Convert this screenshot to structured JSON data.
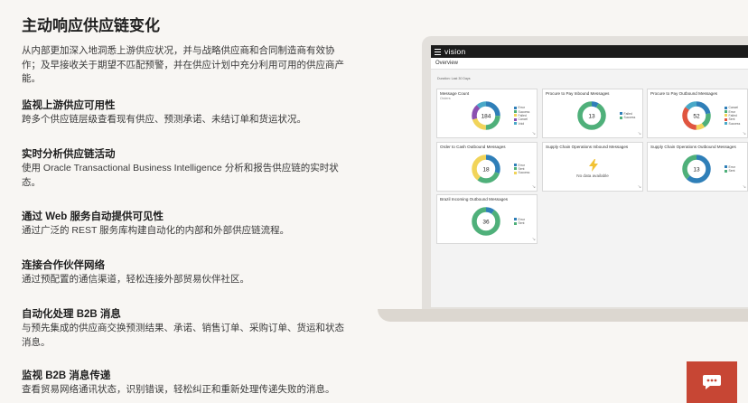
{
  "title": "主动响应供应链变化",
  "lead": "从内部更加深入地洞悉上游供应状况，并与战略供应商和合同制造商有效协作；及早接收关于期望不匹配预警，并在供应计划中充分利用可用的供应商产能。",
  "features": [
    {
      "heading": "监视上游供应可用性",
      "body": "跨多个供应链层级查看现有供应、预测承诺、未结订单和货运状况。"
    },
    {
      "heading": "实时分析供应链活动",
      "body": "使用 Oracle Transactional Business Intelligence 分析和报告供应链的实时状态。"
    },
    {
      "heading": "通过 Web 服务自动提供可见性",
      "body": "通过广泛的 REST 服务库构建自动化的内部和外部供应链流程。"
    },
    {
      "heading": "连接合作伙伴网络",
      "body": "通过预配置的通信渠道，轻松连接外部贸易伙伴社区。"
    },
    {
      "heading": "自动化处理 B2B 消息",
      "body": "与预先集成的供应商交换预测结果、承诺、销售订单、采购订单、货运和状态消息。"
    },
    {
      "heading": "监视 B2B 消息传递",
      "body": "查看贸易网络通讯状态，识别错误，轻松纠正和重新处理传递失败的消息。"
    }
  ],
  "screen": {
    "brand": "vision",
    "page": "Overview",
    "duration": "Duration: Last 30 Days",
    "cards": [
      {
        "title": "Message Count",
        "subtitle": "Orders",
        "total": "184",
        "segments": [
          {
            "label": "Error",
            "color": "#2f7fb8",
            "value": 0.25
          },
          {
            "label": "Success",
            "color": "#4fb07a",
            "value": 0.25
          },
          {
            "label": "Failed",
            "color": "#f1d45a",
            "value": 0.2
          },
          {
            "label": "Cancel",
            "color": "#8b4fb0",
            "value": 0.18
          },
          {
            "label": "Void",
            "color": "#49a9c8",
            "value": 0.12
          }
        ]
      },
      {
        "title": "Procure to Pay Inbound Messages",
        "subtitle": "",
        "total": "13",
        "segments": [
          {
            "label": "Failed",
            "color": "#2f7fb8",
            "value": 0.08
          },
          {
            "label": "Success",
            "color": "#4fb07a",
            "value": 0.92
          }
        ]
      },
      {
        "title": "Procure to Pay Outbound Messages",
        "subtitle": "",
        "total": "52",
        "segments": [
          {
            "label": "Cancel",
            "color": "#2f7fb8",
            "value": 0.22
          },
          {
            "label": "Error",
            "color": "#4fb07a",
            "value": 0.18
          },
          {
            "label": "Failed",
            "color": "#f1d45a",
            "value": 0.1
          },
          {
            "label": "Sent",
            "color": "#e0553f",
            "value": 0.35
          },
          {
            "label": "Success",
            "color": "#49a9c8",
            "value": 0.15
          }
        ]
      },
      {
        "title": "Order to Cash Outbound Messages",
        "subtitle": "",
        "total": "18",
        "segments": [
          {
            "label": "Error",
            "color": "#2f7fb8",
            "value": 0.3
          },
          {
            "label": "Sent",
            "color": "#4fb07a",
            "value": 0.3
          },
          {
            "label": "Success",
            "color": "#f1d45a",
            "value": 0.4
          }
        ]
      },
      {
        "title": "Supply Chain Operations Inbound Messages",
        "subtitle": "",
        "total": "",
        "no_data": "No data available",
        "segments": []
      },
      {
        "title": "Supply Chain Operations Outbound Messages",
        "subtitle": "",
        "total": "13",
        "segments": [
          {
            "label": "Error",
            "color": "#2f7fb8",
            "value": 0.62
          },
          {
            "label": "Sent",
            "color": "#4fb07a",
            "value": 0.38
          }
        ]
      },
      {
        "title": "Brazil Incoming Outbound Messages",
        "subtitle": "",
        "total": "36",
        "segments": [
          {
            "label": "Error",
            "color": "#2f7fb8",
            "value": 0.1
          },
          {
            "label": "Sent",
            "color": "#4fb07a",
            "value": 0.9
          }
        ]
      }
    ]
  },
  "icons": {
    "chat": "chat-bubble-icon",
    "menu": "hamburger-icon",
    "resize": "resize-handle-icon",
    "no_data": "lightning-icon"
  },
  "colors": {
    "chat_button": "#c74634",
    "topbar": "#1b1b1b"
  }
}
